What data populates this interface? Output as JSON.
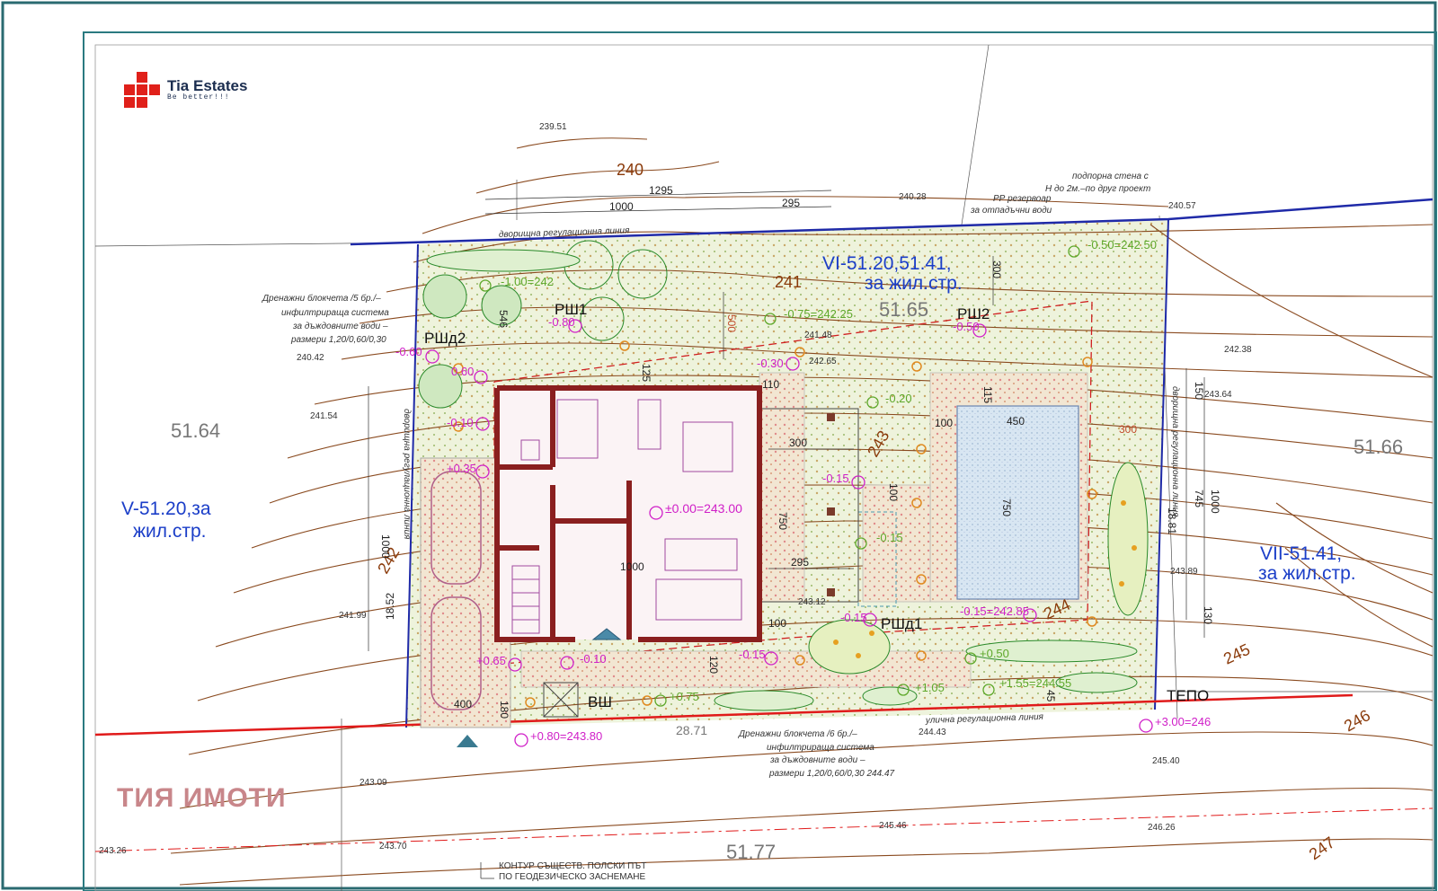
{
  "brand": {
    "name": "Tia Estates",
    "tagline": "Be better!!!",
    "color": "#e0201a"
  },
  "watermark": "ТИЯ ИМОТИ",
  "colors": {
    "contour": "#8a4a1f",
    "regulation_blue": "#1f2aa8",
    "street_red": "#e01a1a",
    "mark_magenta": "#d020c8",
    "mark_green": "#5ea82a",
    "wall": "#8a1f1f",
    "parcel_label": "#1b3ec8"
  },
  "parcels": {
    "p1": "51.64",
    "p2": "51.65",
    "p3": "51.66",
    "p4": "51.77"
  },
  "zones": {
    "z1a": "VI-51.20,51.41,",
    "z1b": "за жил.стр.",
    "z2a": "V-51.20,за",
    "z2b": "жил.стр.",
    "z3a": "VII-51.41,",
    "z3b": "за жил.стр."
  },
  "contours": {
    "c240": "240",
    "c241": "241",
    "c242": "242",
    "c243": "243",
    "c244": "244",
    "c245": "245",
    "c246": "246",
    "c247": "247"
  },
  "spot_levels": {
    "s1": "239.51",
    "s2": "240.28",
    "s3": "240.57",
    "s4": "240.42",
    "s5": "241.54",
    "s6": "241.48",
    "s7": "242.65",
    "s8": "242.38",
    "s9": "243.64",
    "s10": "243.89",
    "s11": "243.12",
    "s12": "241.99",
    "s13": "244.43",
    "s14": "245.40",
    "s15": "243.09",
    "s16": "245.46",
    "s17": "246.26",
    "s18": "243.26",
    "s19": "243.70"
  },
  "dimensions": {
    "d1": "1295",
    "d2": "1000",
    "d3": "295",
    "d4": "500",
    "d5": "300",
    "d6": "750",
    "d7": "295",
    "d8": "1000",
    "d9": "300",
    "d10": "450",
    "d11": "100",
    "d12": "115",
    "d13": "750",
    "d14": "745",
    "d15": "1000",
    "d16": "18.52",
    "d17": "1000",
    "d18": "400",
    "d19": "18.81",
    "d20": "130",
    "d21": "28.71",
    "d22": "300",
    "d23": "100",
    "d24": "120",
    "d25": "100",
    "d26": "110",
    "d27": "150",
    "d28": "546",
    "d29": "45",
    "d30": "180",
    "d31": "125"
  },
  "levels_magenta": {
    "m1": "±0.00=243.00",
    "m2": "-0.80",
    "m3": "-0.50",
    "m4": "-0.60",
    "m5": "0.60",
    "m6": "-0.10",
    "m7": "+0.35",
    "m8": "-0.30",
    "m9": "-0.15",
    "m10": "-0.15",
    "m11": "-0.15=242.85",
    "m12": "-0.15",
    "m13": "+0.65",
    "m14": "-0.10",
    "m15": "+0.80=243.80",
    "m16": "+3.00=246"
  },
  "levels_green": {
    "g1": "-1.00=242",
    "g2": "-0.75=242.25",
    "g3": "-0.50=242.50",
    "g4": "-0.20",
    "g5": "-0.15",
    "g6": "+0.50",
    "g7": "+1.05",
    "g8": "+1.55=244.55",
    "g9": "+0.75"
  },
  "labels": {
    "rsh1": "РШ1",
    "rsh2": "РШ2",
    "rshd1": "РШд1",
    "rshd2": "РШд2",
    "vsh": "ВШ",
    "tepo": "ТЕПО",
    "yard_line": "дворищна регулационна линия",
    "street_line": "улична регулационна линия",
    "side_line_l": "дворищна регулационна линия",
    "side_line_r": "дворищна регулационна линия"
  },
  "notes": {
    "wall1": "подпорна стена с",
    "wall2": "Н до 2м.–по друг проект",
    "tank1": "РР резервоар",
    "tank2": "за отпадъчни води",
    "drainA1": "Дренажни блокчета /5 бр./–",
    "drainA2": "инфилтрираща система",
    "drainA3": "за дъждовните води –",
    "drainA4": "размери 1,20/0,60/0,30",
    "drainB1": "Дренажни блокчета /6 бр./–",
    "drainB2": "инфилтрираща система",
    "drainB3": "за дъждовните води –",
    "drainB4": "размери 1,20/0,60/0,30 244.47",
    "survey1": "КОНТУР СЪЩЕСТВ. ПОЛСКИ ПЪТ",
    "survey2": "ПО ГЕОДЕЗИЧЕСКО ЗАСНЕМАНЕ"
  }
}
